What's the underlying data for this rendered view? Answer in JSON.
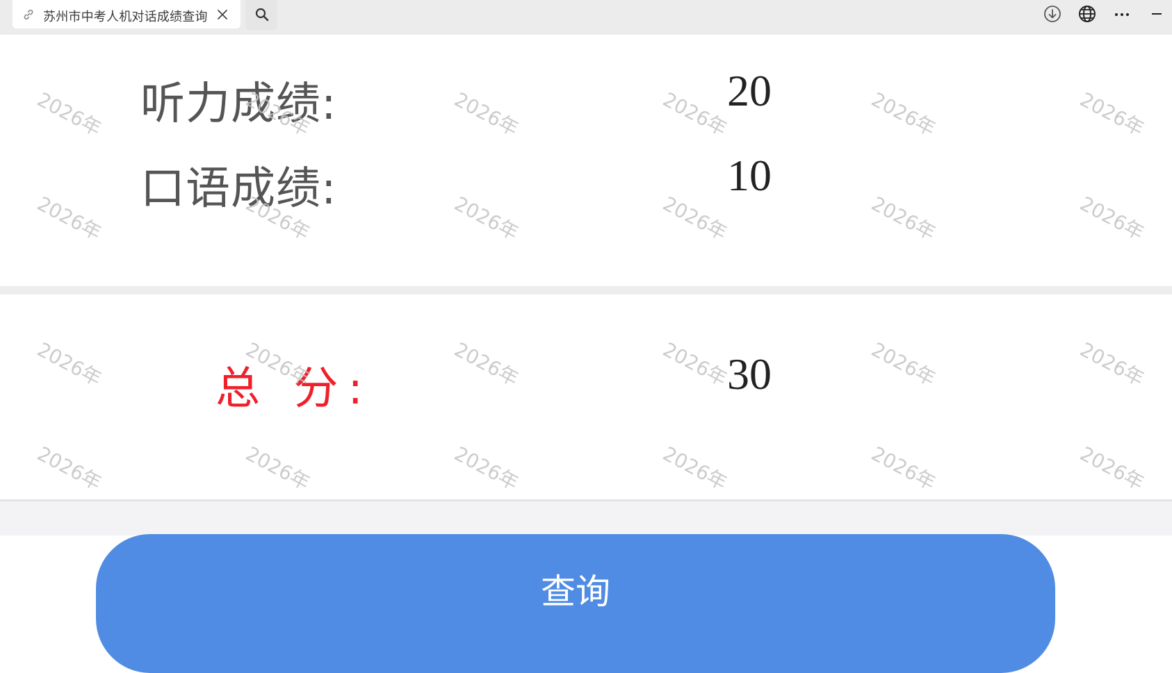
{
  "browser": {
    "tab_title": "苏州市中考人机对话成绩查询",
    "icons": [
      "link-icon",
      "close-icon",
      "search-icon",
      "download-icon",
      "globe-icon",
      "more-icon",
      "minimize-icon"
    ]
  },
  "scores": {
    "listening_label": "听力成绩:",
    "listening_value": "20",
    "speaking_label": "口语成绩:",
    "speaking_value": "10",
    "total_label": "总 分:",
    "total_value": "30"
  },
  "watermark": "2026年",
  "query_button": "查询",
  "colors": {
    "total_label": "#f0202a",
    "button": "#508ce3",
    "label": "#555555",
    "value": "#222222"
  }
}
